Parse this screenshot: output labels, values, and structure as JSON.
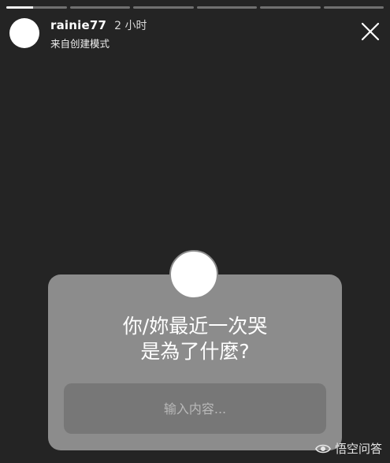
{
  "progress": {
    "segment_count": 6,
    "active_index": 0,
    "active_fill": 0.45
  },
  "header": {
    "username": "rainie77",
    "time_ago": "2 小时",
    "subtitle": "来自创建模式",
    "close_icon": "close-icon"
  },
  "question_card": {
    "line1": "你/妳最近一次哭",
    "line2": "是為了什麼?",
    "input_placeholder": "输入内容..."
  },
  "watermark": {
    "text": "悟空问答",
    "icon": "eye-icon"
  },
  "colors": {
    "background": "#242424",
    "card": "#8c8c8c",
    "input": "#777777"
  }
}
